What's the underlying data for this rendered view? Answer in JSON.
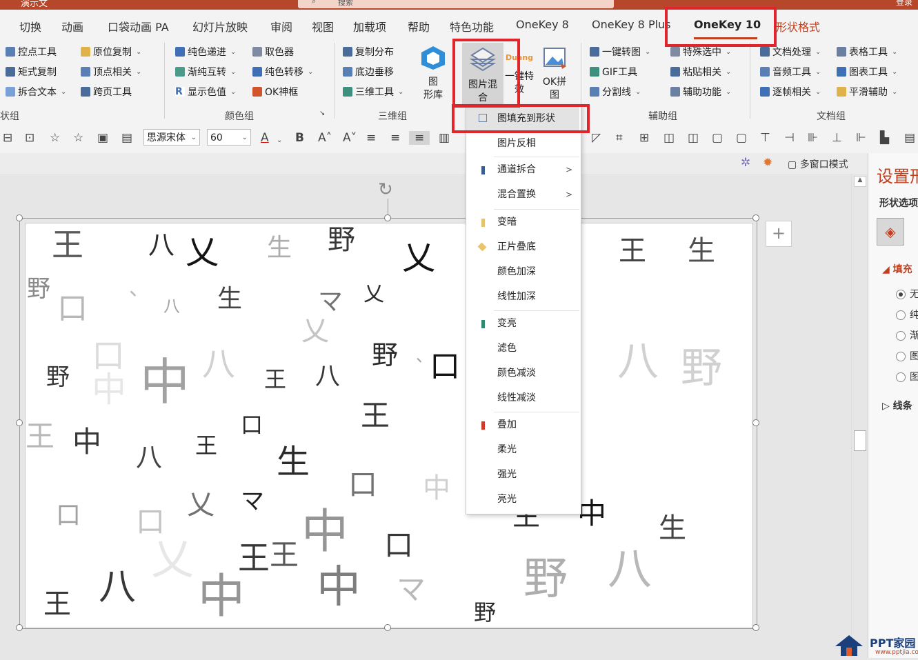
{
  "titlebar": {
    "left_text": "演示文",
    "search_placeholder": "搜索",
    "right_text": "登录"
  },
  "tabs": [
    {
      "label": "切换"
    },
    {
      "label": "动画"
    },
    {
      "label": "口袋动画 PA"
    },
    {
      "label": "幻灯片放映"
    },
    {
      "label": "审阅"
    },
    {
      "label": "视图"
    },
    {
      "label": "加载项"
    },
    {
      "label": "帮助"
    },
    {
      "label": "特色功能"
    },
    {
      "label": "OneKey 8"
    },
    {
      "label": "OneKey 8 Plus"
    },
    {
      "label": "OneKey 10"
    },
    {
      "label": "形状格式"
    }
  ],
  "ribbon": {
    "col1": [
      "控点工具",
      "矩式复制",
      "拆合文本"
    ],
    "col2": [
      "原位复制",
      "顶点相关",
      "跨页工具"
    ],
    "col3": [
      "纯色递进",
      "渐纯互转",
      "显示色值"
    ],
    "col4": [
      "取色器",
      "纯色转移",
      "OK神框"
    ],
    "col5": [
      "复制分布",
      "底边垂移",
      "三维工具"
    ],
    "big_gallery": "图\n形库",
    "big_blend": "图片混\n合",
    "big_effect": "一键特\n效",
    "big_puzzle": "OK拼\n图",
    "col6": [
      "一键转图",
      "GIF工具",
      "分割线"
    ],
    "col7": [
      "特殊选中",
      "粘贴相关",
      "辅助功能"
    ],
    "col8": [
      "文档处理",
      "音频工具",
      "逐帧相关"
    ],
    "col9": [
      "表格工具",
      "图表工具",
      "平滑辅助"
    ],
    "groups": [
      "状组",
      "颜色组",
      "三维组",
      "辅助组",
      "文档组"
    ],
    "effect_badge": "Duang"
  },
  "format": {
    "font": "思源宋体",
    "size": "60"
  },
  "view": {
    "multiwindow": "多窗口模式"
  },
  "menu": {
    "items": [
      {
        "label": "图填充到形状",
        "mark": "",
        "sub": ""
      },
      {
        "label": "图片反相",
        "mark": "",
        "sub": ""
      },
      {
        "label": "通道拆合",
        "mark": "#3a5f8f",
        "sub": ">"
      },
      {
        "label": "混合置换",
        "mark": "",
        "sub": ">"
      },
      {
        "label": "变暗",
        "mark": "#e5c36b",
        "sub": ""
      },
      {
        "label": "正片叠底",
        "mark": "",
        "sub": ""
      },
      {
        "label": "颜色加深",
        "mark": "",
        "sub": ""
      },
      {
        "label": "线性加深",
        "mark": "",
        "sub": ""
      },
      {
        "label": "变亮",
        "mark": "#2e8b6f",
        "sub": ""
      },
      {
        "label": "滤色",
        "mark": "",
        "sub": ""
      },
      {
        "label": "颜色减淡",
        "mark": "",
        "sub": ""
      },
      {
        "label": "线性减淡",
        "mark": "",
        "sub": ""
      },
      {
        "label": "叠加",
        "mark": "#d23b2b",
        "sub": ""
      },
      {
        "label": "柔光",
        "mark": "",
        "sub": ""
      },
      {
        "label": "强光",
        "mark": "",
        "sub": ""
      },
      {
        "label": "亮光",
        "mark": "",
        "sub": ""
      }
    ]
  },
  "pane": {
    "title": "设置形",
    "subtitle": "形状选项",
    "fill_header": "填充",
    "options": [
      "无",
      "纯",
      "渐",
      "图",
      "图"
    ],
    "line_header": "线条"
  },
  "slide_chars": {
    "glyphs": [
      "王",
      "八",
      "乂",
      "生",
      "野",
      "乂",
      "野",
      "口",
      "、",
      "八",
      "生",
      "マ",
      "乂",
      "乂",
      "口",
      "、",
      "中",
      "八",
      "王",
      "野",
      "中",
      "八",
      "野",
      "口",
      "王",
      "口",
      "中",
      "王",
      "八",
      "王",
      "生",
      "口",
      "乂",
      "中",
      "口",
      "マ",
      "中",
      "口",
      "乂",
      "王",
      "口",
      "中",
      "マ",
      "王",
      "中",
      "八",
      "王",
      "野",
      "野",
      "八",
      "生",
      "中",
      "生",
      "王",
      "生",
      "野",
      "八"
    ]
  },
  "watermark": {
    "text": "PPT家园",
    "url": "www.pptjia.com"
  },
  "colors": {
    "accent": "#c43e1c",
    "highlight": "#e0262b",
    "titlebar": "#b7472a"
  }
}
